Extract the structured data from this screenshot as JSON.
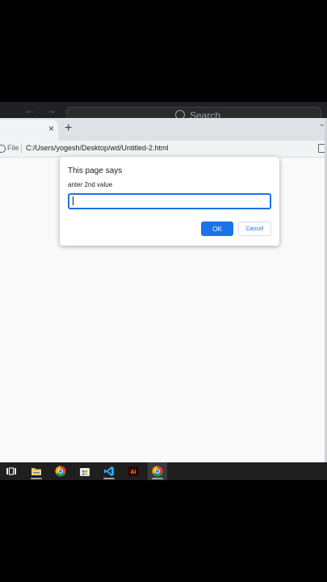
{
  "browser": {
    "search_placeholder": "Search",
    "tab_close": "×",
    "new_tab": "+",
    "address": {
      "scheme_label": "File",
      "url": "C:/Users/yogesh/Desktop/wd/Untitled-2.html"
    }
  },
  "dialog": {
    "title": "This page says",
    "message": "anter 2nd value",
    "input_value": "",
    "ok_label": "OK",
    "cancel_label": "Cancel"
  },
  "taskbar": {
    "items": [
      {
        "icon": "task-view-icon"
      },
      {
        "icon": "file-explorer-icon"
      },
      {
        "icon": "chrome-icon"
      },
      {
        "icon": "microsoft-store-icon"
      },
      {
        "icon": "vscode-icon"
      },
      {
        "icon": "adobe-illustrator-icon",
        "text": "Ai"
      },
      {
        "icon": "chrome-icon"
      }
    ]
  },
  "colors": {
    "accent": "#1a73e8",
    "taskbar": "#1f1f1f",
    "page_bg": "#f9f9f9"
  }
}
